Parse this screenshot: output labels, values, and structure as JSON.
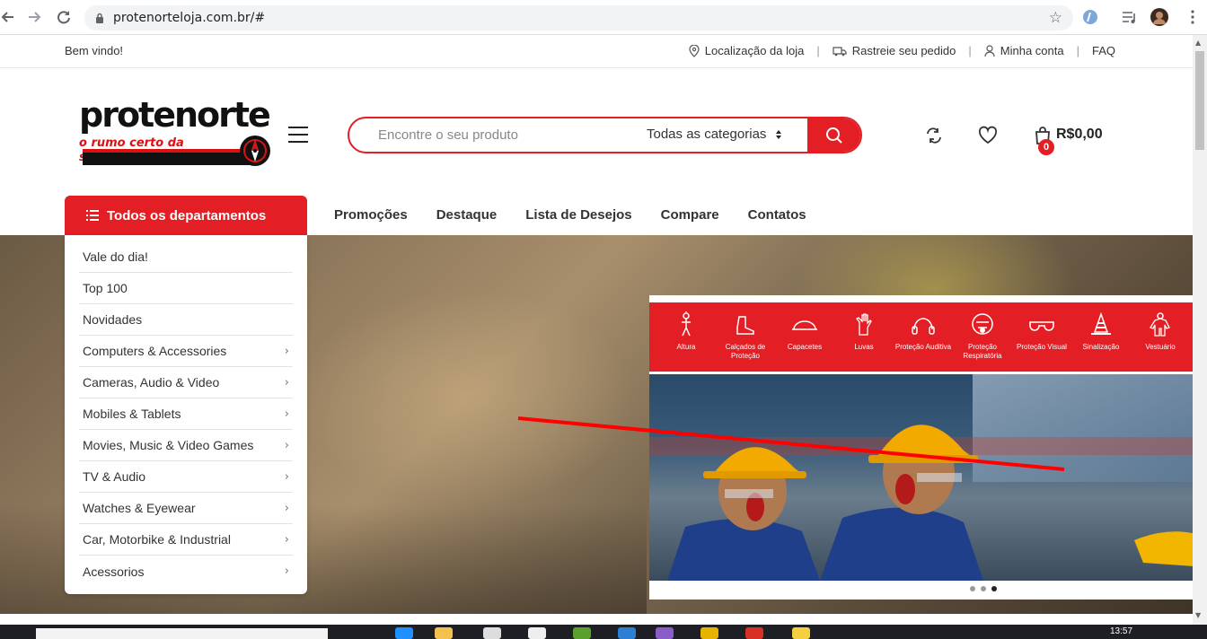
{
  "browser": {
    "url": "protenorteloja.com.br/#",
    "back_icon": "arrow-left",
    "forward_icon": "arrow-right",
    "reload_icon": "reload"
  },
  "topbar": {
    "welcome": "Bem vindo!",
    "store_location": "Localização da loja",
    "track_order": "Rastreie seu pedido",
    "my_account": "Minha conta",
    "faq": "FAQ"
  },
  "logo": {
    "name": "protenorte",
    "tagline": "o rumo certo da segurança"
  },
  "search": {
    "placeholder": "Encontre o seu produto",
    "category": "Todas as categorias"
  },
  "cart": {
    "count": "0",
    "total": "R$0,00"
  },
  "nav": {
    "departments_label": "Todos os departamentos",
    "items": [
      "Promoções",
      "Destaque",
      "Lista de Desejos",
      "Compare",
      "Contatos"
    ]
  },
  "departments": [
    {
      "label": "Vale do dia!",
      "has_sub": false
    },
    {
      "label": "Top 100",
      "has_sub": false
    },
    {
      "label": "Novidades",
      "has_sub": false
    },
    {
      "label": "Computers & Accessories",
      "has_sub": true
    },
    {
      "label": "Cameras, Audio & Video",
      "has_sub": true
    },
    {
      "label": "Mobiles & Tablets",
      "has_sub": true
    },
    {
      "label": "Movies, Music & Video Games",
      "has_sub": true
    },
    {
      "label": "TV & Audio",
      "has_sub": true
    },
    {
      "label": "Watches & Eyewear",
      "has_sub": true
    },
    {
      "label": "Car, Motorbike & Industrial",
      "has_sub": true
    },
    {
      "label": "Acessorios",
      "has_sub": true
    }
  ],
  "categories": [
    {
      "label": "Altura",
      "icon": "harness-icon"
    },
    {
      "label": "Calçados de Proteção",
      "icon": "boot-icon"
    },
    {
      "label": "Capacetes",
      "icon": "helmet-icon"
    },
    {
      "label": "Luvas",
      "icon": "glove-icon"
    },
    {
      "label": "Proteção Auditiva",
      "icon": "earmuff-icon"
    },
    {
      "label": "Proteção Respiratória",
      "icon": "respirator-icon"
    },
    {
      "label": "Proteção Visual",
      "icon": "goggles-icon"
    },
    {
      "label": "Sinalização",
      "icon": "cone-icon"
    },
    {
      "label": "Vestuário",
      "icon": "coverall-icon"
    }
  ],
  "slider": {
    "active_dot": 3,
    "total_dots": 3
  },
  "taskbar": {
    "time": "13:57"
  },
  "colors": {
    "brand_red": "#e31e24",
    "text_dark": "#333333"
  }
}
